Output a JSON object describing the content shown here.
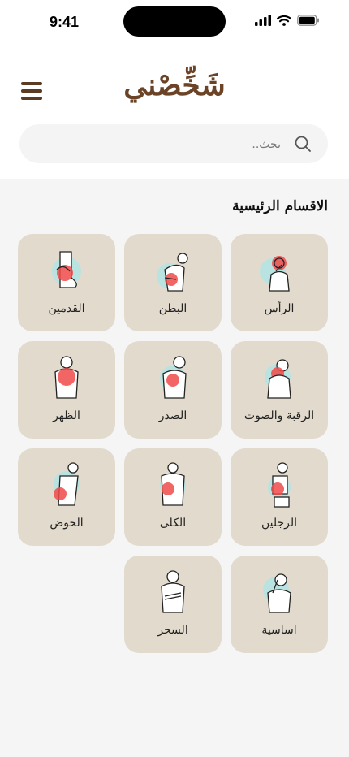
{
  "status": {
    "time": "9:41"
  },
  "header": {
    "logo_text": "شَخِّصْني"
  },
  "search": {
    "placeholder": "بحث.."
  },
  "section": {
    "title": "الاقسام الرئيسية"
  },
  "categories": [
    {
      "label": "الرأس",
      "pose": "head"
    },
    {
      "label": "البطن",
      "pose": "belly"
    },
    {
      "label": "القدمين",
      "pose": "feet"
    },
    {
      "label": "الرقبة والصوت",
      "pose": "neck"
    },
    {
      "label": "الصدر",
      "pose": "chest"
    },
    {
      "label": "الظهر",
      "pose": "back"
    },
    {
      "label": "الرجلين",
      "pose": "legs"
    },
    {
      "label": "الكلى",
      "pose": "kidney"
    },
    {
      "label": "الحوض",
      "pose": "pelvis"
    },
    {
      "label": "اساسية",
      "pose": "basic"
    },
    {
      "label": "السحر",
      "pose": "magic"
    }
  ],
  "colors": {
    "card": "#e2dbcd",
    "accent": "#6b4427",
    "pain": "#ef4a4a",
    "halo": "#b9e3e0"
  }
}
